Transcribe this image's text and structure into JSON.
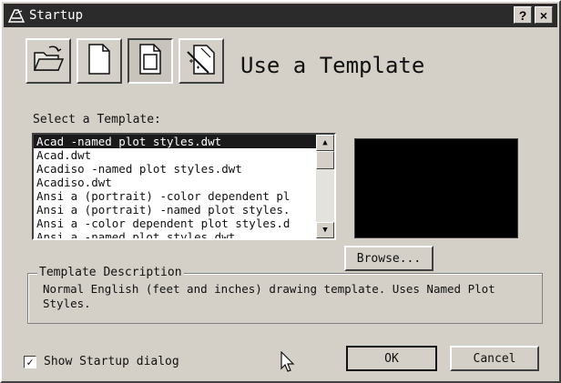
{
  "window": {
    "title": "Startup",
    "help_label": "?",
    "close_label": "×"
  },
  "mode_buttons": [
    {
      "name": "open-drawing-button",
      "icon": "open-folder-icon"
    },
    {
      "name": "start-from-scratch-button",
      "icon": "blank-page-icon"
    },
    {
      "name": "use-template-button",
      "icon": "template-icon",
      "active": true
    },
    {
      "name": "use-wizard-button",
      "icon": "wizard-icon"
    }
  ],
  "heading": "Use a Template",
  "template_list": {
    "label": "Select a Template:",
    "items": [
      {
        "label": "Acad -named plot styles.dwt",
        "selected": true
      },
      {
        "label": "Acad.dwt"
      },
      {
        "label": "Acadiso -named plot styles.dwt"
      },
      {
        "label": "Acadiso.dwt"
      },
      {
        "label": "Ansi a (portrait) -color dependent pl"
      },
      {
        "label": "Ansi a (portrait) -named plot styles."
      },
      {
        "label": "Ansi a -color dependent plot styles.d"
      },
      {
        "label": "Ansi a -named plot styles.dwt"
      }
    ]
  },
  "browse_label": "Browse...",
  "description": {
    "title": "Template Description",
    "text": "Normal English (feet and inches) drawing template.  Uses Named Plot Styles."
  },
  "show_startup": {
    "label": "Show Startup dialog",
    "checked": true,
    "check_mark": "✓"
  },
  "ok_label": "OK",
  "cancel_label": "Cancel"
}
